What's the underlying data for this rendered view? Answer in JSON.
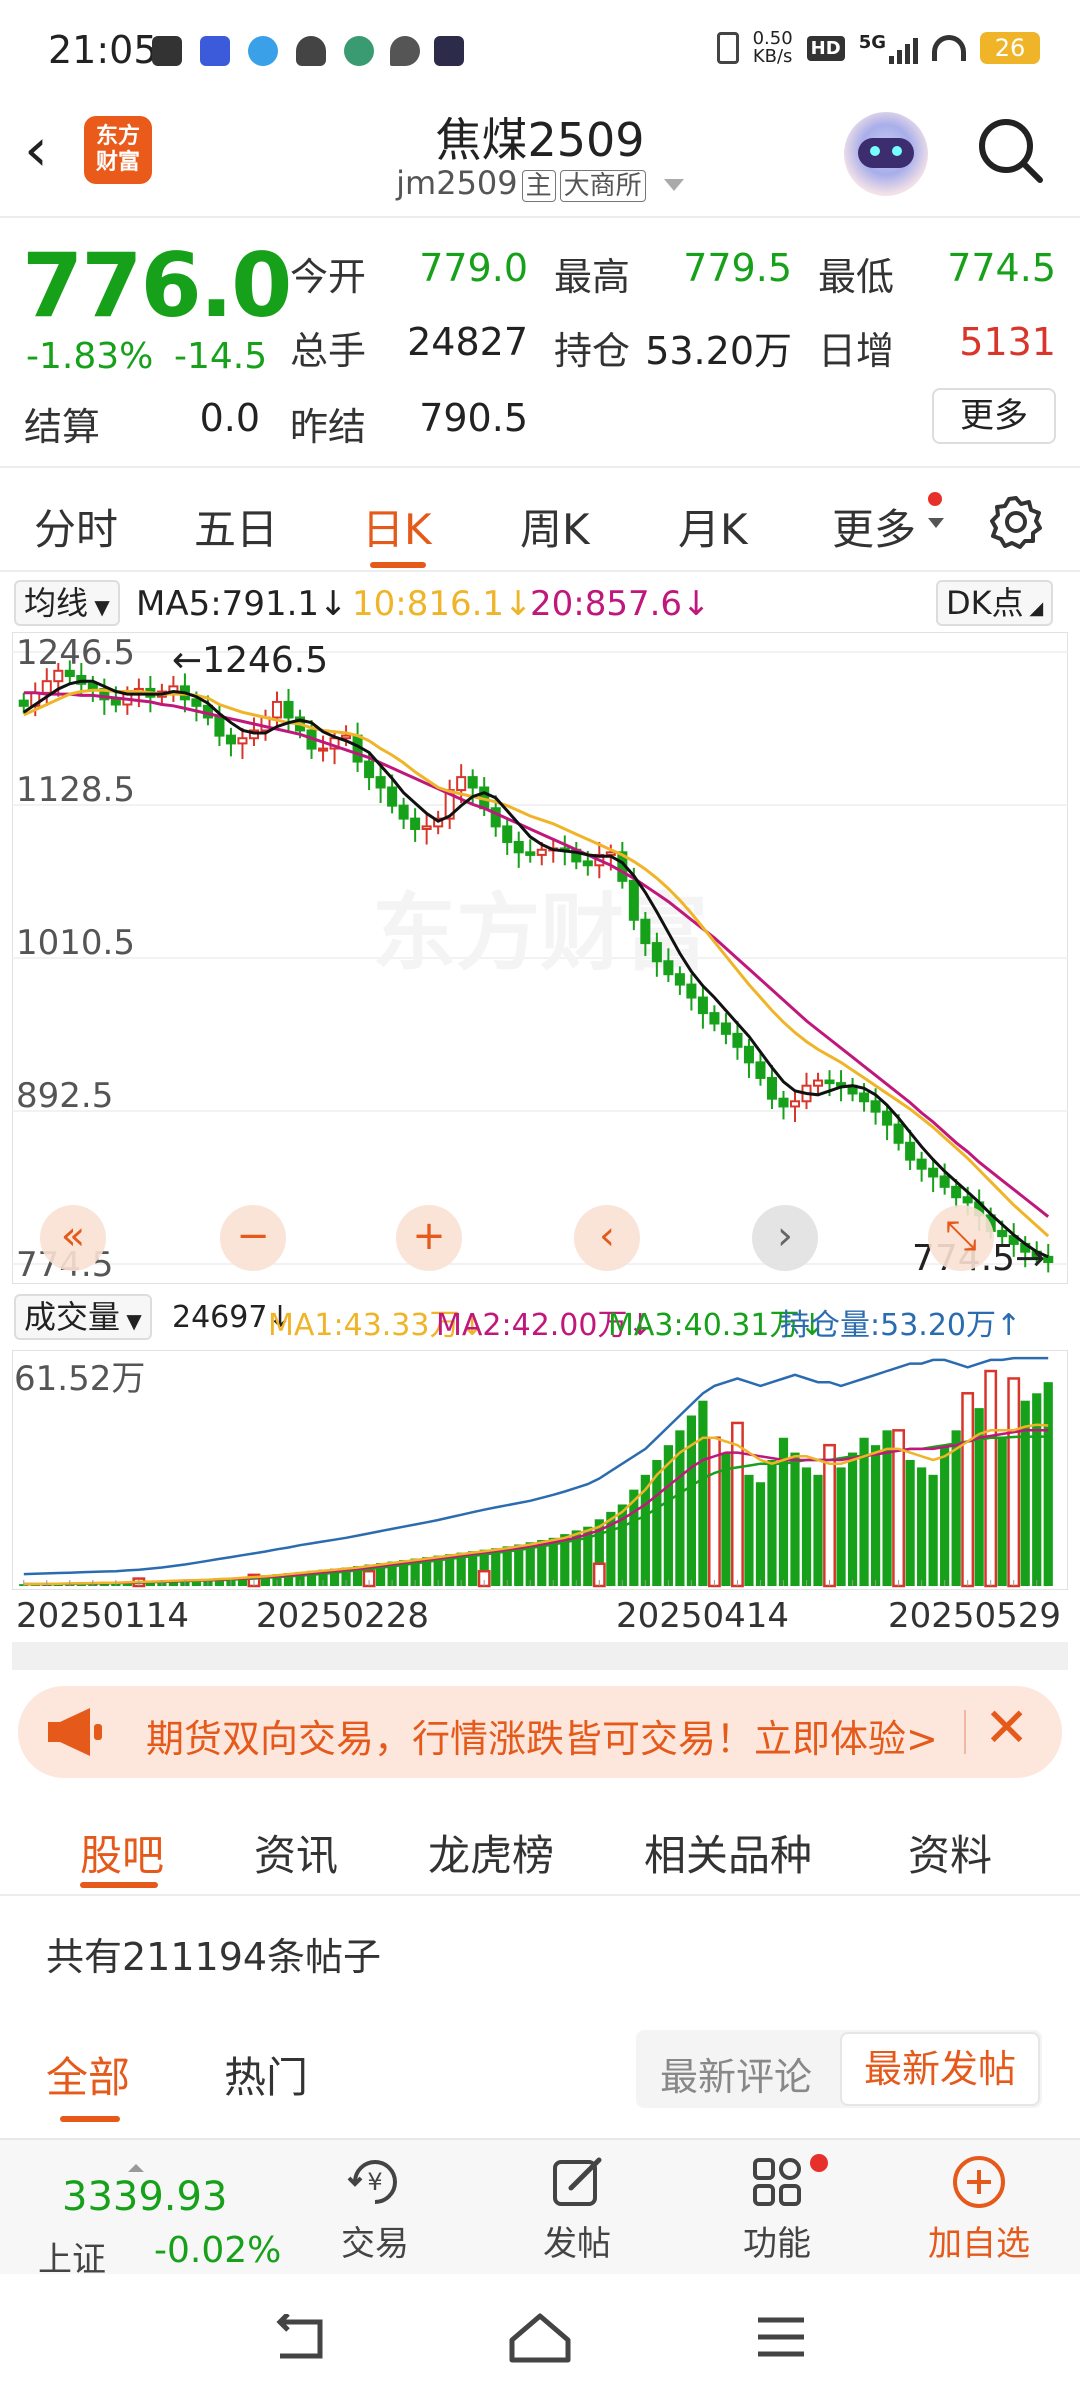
{
  "status": {
    "time": "21:05",
    "net_speed_value": "0.50",
    "net_speed_unit": "KB/s",
    "hd": "HD",
    "signal": "5G",
    "battery": "26"
  },
  "header": {
    "logo_line1": "东方",
    "logo_line2": "财富",
    "title": "焦煤2509",
    "code": "jm2509",
    "tag_main": "主",
    "tag_exchange": "大商所"
  },
  "quote": {
    "price": "776.0",
    "change_pct": "-1.83%",
    "change": "-14.5",
    "open_label": "今开",
    "open": "779.0",
    "high_label": "最高",
    "high": "779.5",
    "low_label": "最低",
    "low": "774.5",
    "volume_label": "总手",
    "volume": "24827",
    "oi_label": "持仓",
    "oi": "53.20万",
    "daily_inc_label": "日增",
    "daily_inc": "5131",
    "settle_label": "结算",
    "settle": "0.0",
    "prev_settle_label": "昨结",
    "prev_settle": "790.5",
    "more_label": "更多"
  },
  "tabs": [
    {
      "label": "分时"
    },
    {
      "label": "五日"
    },
    {
      "label": "日K"
    },
    {
      "label": "周K"
    },
    {
      "label": "月K"
    },
    {
      "label": "更多"
    }
  ],
  "ma_legend": {
    "selector": "均线",
    "ma5": "MA5:791.1↓",
    "ma10": "10:816.1↓",
    "ma20": "20:857.6↓",
    "dk_label": "DK点"
  },
  "vol_legend": {
    "selector": "成交量",
    "vol": "24697↓",
    "ma1": "MA1:43.33万↓",
    "ma2": "MA2:42.00万↓",
    "ma3": "MA3:40.31万↓",
    "oi": "持仓量:53.20万↑"
  },
  "colors": {
    "up": "#d8362b",
    "down": "#17a11a",
    "accent": "#e55a1b",
    "ma5": "#111111",
    "ma10": "#f0b429",
    "ma20": "#c0177c",
    "oi_line": "#2b6cb0"
  },
  "chart_data": [
    {
      "type": "candlestick",
      "y_ticks": [
        "1246.5",
        "1128.5",
        "1010.5",
        "892.5",
        "774.5"
      ],
      "ylim": [
        774.5,
        1246.5
      ],
      "annotations": [
        "←1246.5",
        "774.5→"
      ],
      "x_labels": [
        "20250114",
        "20250228",
        "20250414",
        "20250529"
      ],
      "close": [
        1205,
        1215,
        1224,
        1232,
        1228,
        1222,
        1218,
        1210,
        1206,
        1214,
        1218,
        1212,
        1216,
        1220,
        1210,
        1205,
        1196,
        1182,
        1176,
        1180,
        1186,
        1196,
        1208,
        1196,
        1186,
        1172,
        1172,
        1180,
        1182,
        1162,
        1150,
        1142,
        1128,
        1118,
        1110,
        1112,
        1118,
        1140,
        1150,
        1142,
        1126,
        1112,
        1100,
        1092,
        1090,
        1094,
        1095,
        1094,
        1085,
        1082,
        1090,
        1092,
        1070,
        1040,
        1022,
        1008,
        998,
        990,
        980,
        968,
        960,
        952,
        942,
        930,
        918,
        902,
        896,
        900,
        912,
        916,
        914,
        912,
        906,
        900,
        892,
        882,
        868,
        855,
        848,
        842,
        834,
        826,
        822,
        812,
        800,
        796,
        790,
        784,
        780,
        776
      ],
      "ma5": [
        1200,
        1206,
        1212,
        1218,
        1222,
        1224,
        1224,
        1220,
        1216,
        1214,
        1214,
        1214,
        1214,
        1216,
        1215,
        1212,
        1207,
        1199,
        1192,
        1186,
        1184,
        1184,
        1189,
        1192,
        1194,
        1192,
        1185,
        1181,
        1178,
        1174,
        1169,
        1159,
        1149,
        1138,
        1130,
        1122,
        1116,
        1120,
        1128,
        1135,
        1138,
        1134,
        1124,
        1114,
        1104,
        1098,
        1094,
        1093,
        1092,
        1090,
        1089,
        1089,
        1084,
        1074,
        1061,
        1046,
        1030,
        1014,
        1000,
        989,
        980,
        970,
        960,
        950,
        938,
        926,
        915,
        908,
        906,
        905,
        908,
        911,
        912,
        910,
        905,
        897,
        887,
        876,
        865,
        855,
        846,
        838,
        830,
        822,
        813,
        805,
        797,
        790,
        784,
        780
      ],
      "ma10": [
        1198,
        1202,
        1206,
        1210,
        1214,
        1216,
        1217,
        1217,
        1216,
        1216,
        1216,
        1215,
        1214,
        1214,
        1214,
        1213,
        1211,
        1206,
        1203,
        1200,
        1198,
        1196,
        1194,
        1192,
        1191,
        1188,
        1186,
        1185,
        1184,
        1182,
        1178,
        1172,
        1167,
        1161,
        1154,
        1148,
        1142,
        1139,
        1137,
        1135,
        1133,
        1131,
        1128,
        1124,
        1120,
        1117,
        1114,
        1110,
        1106,
        1102,
        1098,
        1094,
        1090,
        1085,
        1079,
        1072,
        1064,
        1055,
        1045,
        1034,
        1023,
        1012,
        1001,
        990,
        980,
        970,
        961,
        953,
        946,
        940,
        935,
        930,
        924,
        918,
        912,
        906,
        900,
        894,
        887,
        880,
        872,
        864,
        856,
        847,
        838,
        829,
        820,
        812,
        804,
        796
      ],
      "ma20": [
        1215,
        1215,
        1214,
        1214,
        1214,
        1213,
        1213,
        1212,
        1211,
        1210,
        1209,
        1208,
        1206,
        1205,
        1203,
        1201,
        1199,
        1197,
        1195,
        1193,
        1191,
        1189,
        1187,
        1185,
        1183,
        1180,
        1177,
        1174,
        1171,
        1168,
        1165,
        1161,
        1157,
        1153,
        1149,
        1145,
        1141,
        1137,
        1133,
        1129,
        1126,
        1122,
        1118,
        1114,
        1110,
        1106,
        1102,
        1098,
        1094,
        1090,
        1086,
        1082,
        1077,
        1072,
        1066,
        1060,
        1054,
        1047,
        1040,
        1033,
        1026,
        1018,
        1010,
        1002,
        994,
        986,
        978,
        970,
        962,
        955,
        948,
        941,
        934,
        927,
        920,
        913,
        906,
        899,
        891,
        884,
        876,
        868,
        861,
        853,
        846,
        839,
        832,
        825,
        818,
        811
      ]
    },
    {
      "type": "bar",
      "y_ticks": [
        "61.52万"
      ],
      "unit": "万",
      "ylim": [
        0,
        61.52
      ],
      "volume": [
        0.5,
        0.6,
        0.6,
        0.7,
        0.8,
        0.8,
        0.9,
        1.0,
        1.0,
        1.1,
        1.2,
        1.3,
        1.4,
        1.5,
        1.6,
        1.7,
        1.8,
        2.0,
        2.2,
        2.4,
        2.6,
        2.9,
        3.2,
        3.5,
        3.8,
        4.1,
        4.4,
        4.7,
        5.0,
        5.4,
        5.8,
        6.2,
        6.6,
        7.0,
        7.4,
        7.8,
        8.2,
        8.6,
        9.0,
        9.4,
        9.8,
        10.2,
        10.7,
        11.2,
        11.8,
        12.4,
        13,
        14,
        15,
        16,
        18,
        20,
        22,
        26,
        30,
        34,
        38,
        42,
        46,
        50,
        40,
        36,
        32,
        30,
        28,
        34,
        40,
        36,
        32,
        30,
        30,
        32,
        36,
        40,
        38,
        42,
        36,
        34,
        32,
        30,
        38,
        42,
        46,
        48,
        44,
        40,
        44,
        50,
        52,
        55
      ],
      "highlight_bars": [
        [
          10,
          2
        ],
        [
          20,
          3
        ],
        [
          30,
          4
        ],
        [
          40,
          4
        ],
        [
          50,
          6
        ],
        [
          60,
          40
        ],
        [
          62,
          44
        ],
        [
          70,
          38
        ],
        [
          76,
          42
        ],
        [
          82,
          52
        ],
        [
          84,
          58
        ],
        [
          86,
          56
        ]
      ],
      "oi_line": [
        3.2,
        3.3,
        3.4,
        3.5,
        3.6,
        3.7,
        3.8,
        3.9,
        4.0,
        4.2,
        4.4,
        4.7,
        5.0,
        5.4,
        5.8,
        6.3,
        6.8,
        7.3,
        7.8,
        8.3,
        8.8,
        9.3,
        9.9,
        10.4,
        11.0,
        11.5,
        12.0,
        12.5,
        13.0,
        13.6,
        14.2,
        14.8,
        15.4,
        16.0,
        16.6,
        17.2,
        17.8,
        18.5,
        19.2,
        19.9,
        20.6,
        21.2,
        21.8,
        22.4,
        23.0,
        23.8,
        24.6,
        25.5,
        26.5,
        27.5,
        29,
        31,
        33,
        35,
        37,
        40,
        43,
        46,
        49,
        52,
        54,
        55,
        56,
        55,
        54,
        55,
        56,
        57,
        56,
        55,
        55,
        54,
        55,
        56,
        57,
        58,
        59,
        60,
        60,
        61,
        61,
        60,
        59,
        60,
        61,
        61,
        61.5,
        61.5,
        61.5,
        61.5
      ],
      "ma1": [
        0.5,
        0.5,
        0.6,
        0.6,
        0.7,
        0.7,
        0.8,
        0.9,
        0.9,
        1.0,
        1.1,
        1.2,
        1.3,
        1.4,
        1.5,
        1.6,
        1.7,
        1.9,
        2.0,
        2.2,
        2.4,
        2.6,
        2.9,
        3.2,
        3.5,
        3.8,
        4.1,
        4.4,
        4.7,
        5.0,
        5.4,
        5.8,
        6.2,
        6.6,
        7.0,
        7.4,
        7.8,
        8.2,
        8.6,
        9.0,
        9.4,
        9.8,
        10.2,
        10.7,
        11.2,
        11.8,
        12.4,
        13,
        14,
        15,
        16,
        18,
        20,
        23,
        26,
        30,
        33,
        36,
        38,
        40,
        40,
        39,
        38,
        36,
        34,
        33,
        34,
        35,
        35,
        34,
        33,
        33,
        34,
        35,
        36,
        37,
        37,
        36,
        35,
        34,
        35,
        37,
        39,
        41,
        42,
        42,
        42,
        43,
        43.5,
        43.3
      ],
      "ma2": [
        0.5,
        0.5,
        0.5,
        0.6,
        0.6,
        0.7,
        0.7,
        0.8,
        0.9,
        0.9,
        1.0,
        1.1,
        1.2,
        1.3,
        1.4,
        1.5,
        1.6,
        1.7,
        1.9,
        2.0,
        2.2,
        2.4,
        2.6,
        2.8,
        3.1,
        3.4,
        3.7,
        4.0,
        4.3,
        4.6,
        5.0,
        5.4,
        5.8,
        6.2,
        6.6,
        7.0,
        7.4,
        7.8,
        8.2,
        8.6,
        9.0,
        9.4,
        9.8,
        10.2,
        10.7,
        11.2,
        11.8,
        12.4,
        13,
        14,
        15,
        16.5,
        18,
        20,
        22,
        24.5,
        27,
        29.5,
        32,
        34,
        35,
        36,
        36,
        35.5,
        35,
        34.5,
        34,
        34,
        34,
        34,
        34,
        34,
        34.5,
        35,
        35.5,
        36,
        36.5,
        37,
        37,
        37,
        37.5,
        38,
        39,
        40,
        40.5,
        41,
        41.5,
        42,
        42,
        42
      ],
      "ma3": [
        0.5,
        0.5,
        0.5,
        0.5,
        0.6,
        0.6,
        0.7,
        0.7,
        0.8,
        0.8,
        0.9,
        1.0,
        1.1,
        1.2,
        1.3,
        1.4,
        1.5,
        1.6,
        1.7,
        1.9,
        2.0,
        2.2,
        2.4,
        2.6,
        2.8,
        3.0,
        3.3,
        3.6,
        3.9,
        4.2,
        4.5,
        4.9,
        5.3,
        5.7,
        6.1,
        6.5,
        6.9,
        7.3,
        7.7,
        8.1,
        8.5,
        8.9,
        9.3,
        9.7,
        10.2,
        10.7,
        11.2,
        11.8,
        12.4,
        13,
        14,
        15,
        16,
        17.5,
        19,
        21,
        23,
        25,
        27,
        29,
        30.5,
        31.5,
        32,
        32.5,
        33,
        33,
        33,
        33.5,
        34,
        34,
        34,
        34.5,
        35,
        35,
        35.5,
        36,
        36.5,
        37,
        37,
        37.5,
        38,
        38.5,
        39,
        39.5,
        40,
        40,
        40.2,
        40.3,
        40.3,
        40.3
      ]
    }
  ],
  "nav_buttons": [
    "«",
    "−",
    "+",
    "‹",
    "›",
    "⤡"
  ],
  "watermark": "东方财富",
  "banner": {
    "text": "期货双向交易，行情涨跌皆可交易！立即体验>",
    "close": "✕"
  },
  "sub_tabs": [
    {
      "label": "股吧"
    },
    {
      "label": "资讯"
    },
    {
      "label": "龙虎榜"
    },
    {
      "label": "相关品种"
    },
    {
      "label": "资料"
    }
  ],
  "post_count": "共有211194条帖子",
  "filter": {
    "all": "全部",
    "hot": "热门",
    "sort_latest_comment": "最新评论",
    "sort_latest_post": "最新发帖"
  },
  "bottom": {
    "index_value": "3339.93",
    "index_name": "上证",
    "index_pct": "-0.02%",
    "trade": "交易",
    "post": "发帖",
    "features": "功能",
    "add_watch": "加自选"
  }
}
